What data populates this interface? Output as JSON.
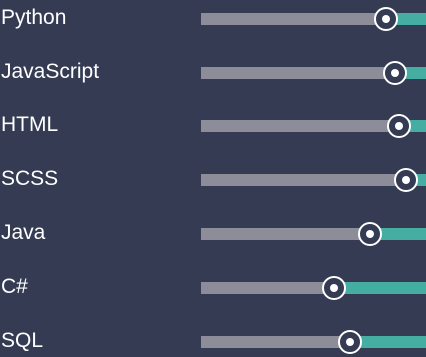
{
  "colors": {
    "background": "#343b52",
    "track_filled": "#8d8c99",
    "track_rest": "#46ada3",
    "thumb": "#ffffff",
    "label": "#ffffff"
  },
  "skills": [
    {
      "label": "Python",
      "level": 0.82
    },
    {
      "label": "JavaScript",
      "level": 0.86
    },
    {
      "label": "HTML",
      "level": 0.88
    },
    {
      "label": "SCSS",
      "level": 0.91
    },
    {
      "label": "Java",
      "level": 0.75
    },
    {
      "label": "C#",
      "level": 0.59
    },
    {
      "label": "SQL",
      "level": 0.66
    }
  ]
}
